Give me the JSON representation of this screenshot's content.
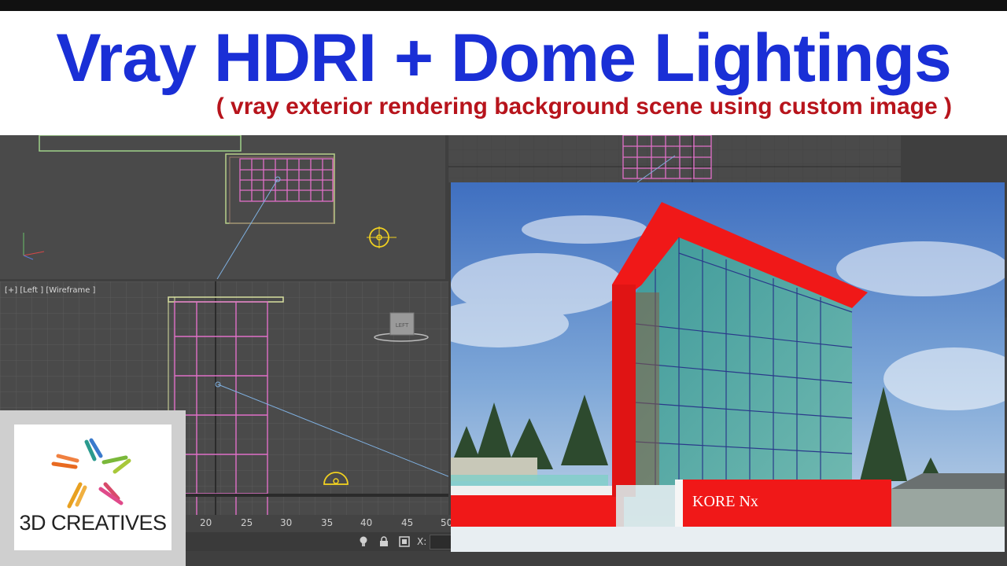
{
  "header": {
    "title": "Vray HDRI + Dome Lightings",
    "subtitle": "( vray exterior rendering background scene using custom image )"
  },
  "viewport": {
    "label": "[+] [Left ] [Wireframe ]",
    "gizmo_label": "LEFT"
  },
  "timeline": {
    "ticks": [
      "20",
      "25",
      "30",
      "35",
      "40",
      "45",
      "50"
    ],
    "coord_label": "X:"
  },
  "logo": {
    "text": "3D CREATIVES"
  },
  "render": {
    "sign_text": "KORE Nx"
  },
  "colors": {
    "title": "#1a2fd6",
    "subtitle": "#b7141c",
    "building_red": "#f01818",
    "glass": "#4f9c9a"
  }
}
